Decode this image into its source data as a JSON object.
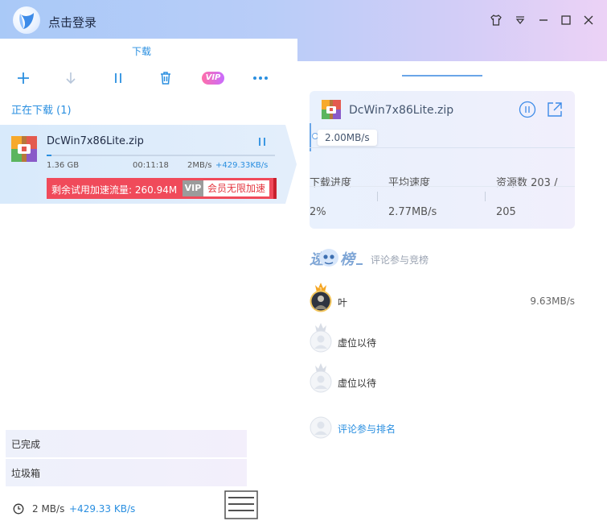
{
  "app": {
    "login_text": "点击登录"
  },
  "left": {
    "tab_label": "下载",
    "toolbar": {
      "vip_label": "VIP"
    },
    "downloading_title": "正在下载 (1)",
    "item": {
      "file_name": "DcWin7x86Lite.zip",
      "size": "1.36 GB",
      "time_left": "00:11:18",
      "speed": "2MB/s",
      "boost": "+429.33KB/s",
      "progress": 0.02,
      "promo_text": "剩余试用加速流量: 260.94M",
      "promo_vip": "VIP",
      "promo_button": "会员无限加速"
    },
    "nav": {
      "completed": "已完成",
      "trash": "垃圾箱"
    },
    "status": {
      "speed": "2 MB/s",
      "boost": "+429.33 KB/s"
    }
  },
  "right": {
    "file_name": "DcWin7x86Lite.zip",
    "speed_tag": "2.00MB/s",
    "stats": {
      "progress_label": "下载进度",
      "avg_speed_label": "平均速度",
      "sources_label": "资源数 203 /",
      "progress_value": "2%",
      "avg_speed_value": "2.77MB/s",
      "sources_value": "205"
    },
    "rank_hint": "评论参与竞榜",
    "rank": [
      {
        "name": "叶",
        "speed": "9.63MB/s"
      },
      {
        "name": "虚位以待",
        "speed": ""
      },
      {
        "name": "虚位以待",
        "speed": ""
      }
    ],
    "comment_label": "评论参与排名"
  },
  "colors": {
    "accent": "#2a8fe0",
    "promo": "#f04a5a",
    "promo_dark": "#c8202d"
  },
  "icons": [
    "app-logo-icon",
    "skin-icon",
    "menu-icon",
    "minimize-icon",
    "maximize-icon",
    "close-icon",
    "add-icon",
    "download-icon",
    "pause-icon",
    "trash-icon",
    "more-icon",
    "zip-file-icon",
    "open-folder-icon",
    "clock-icon",
    "crown-icon"
  ]
}
